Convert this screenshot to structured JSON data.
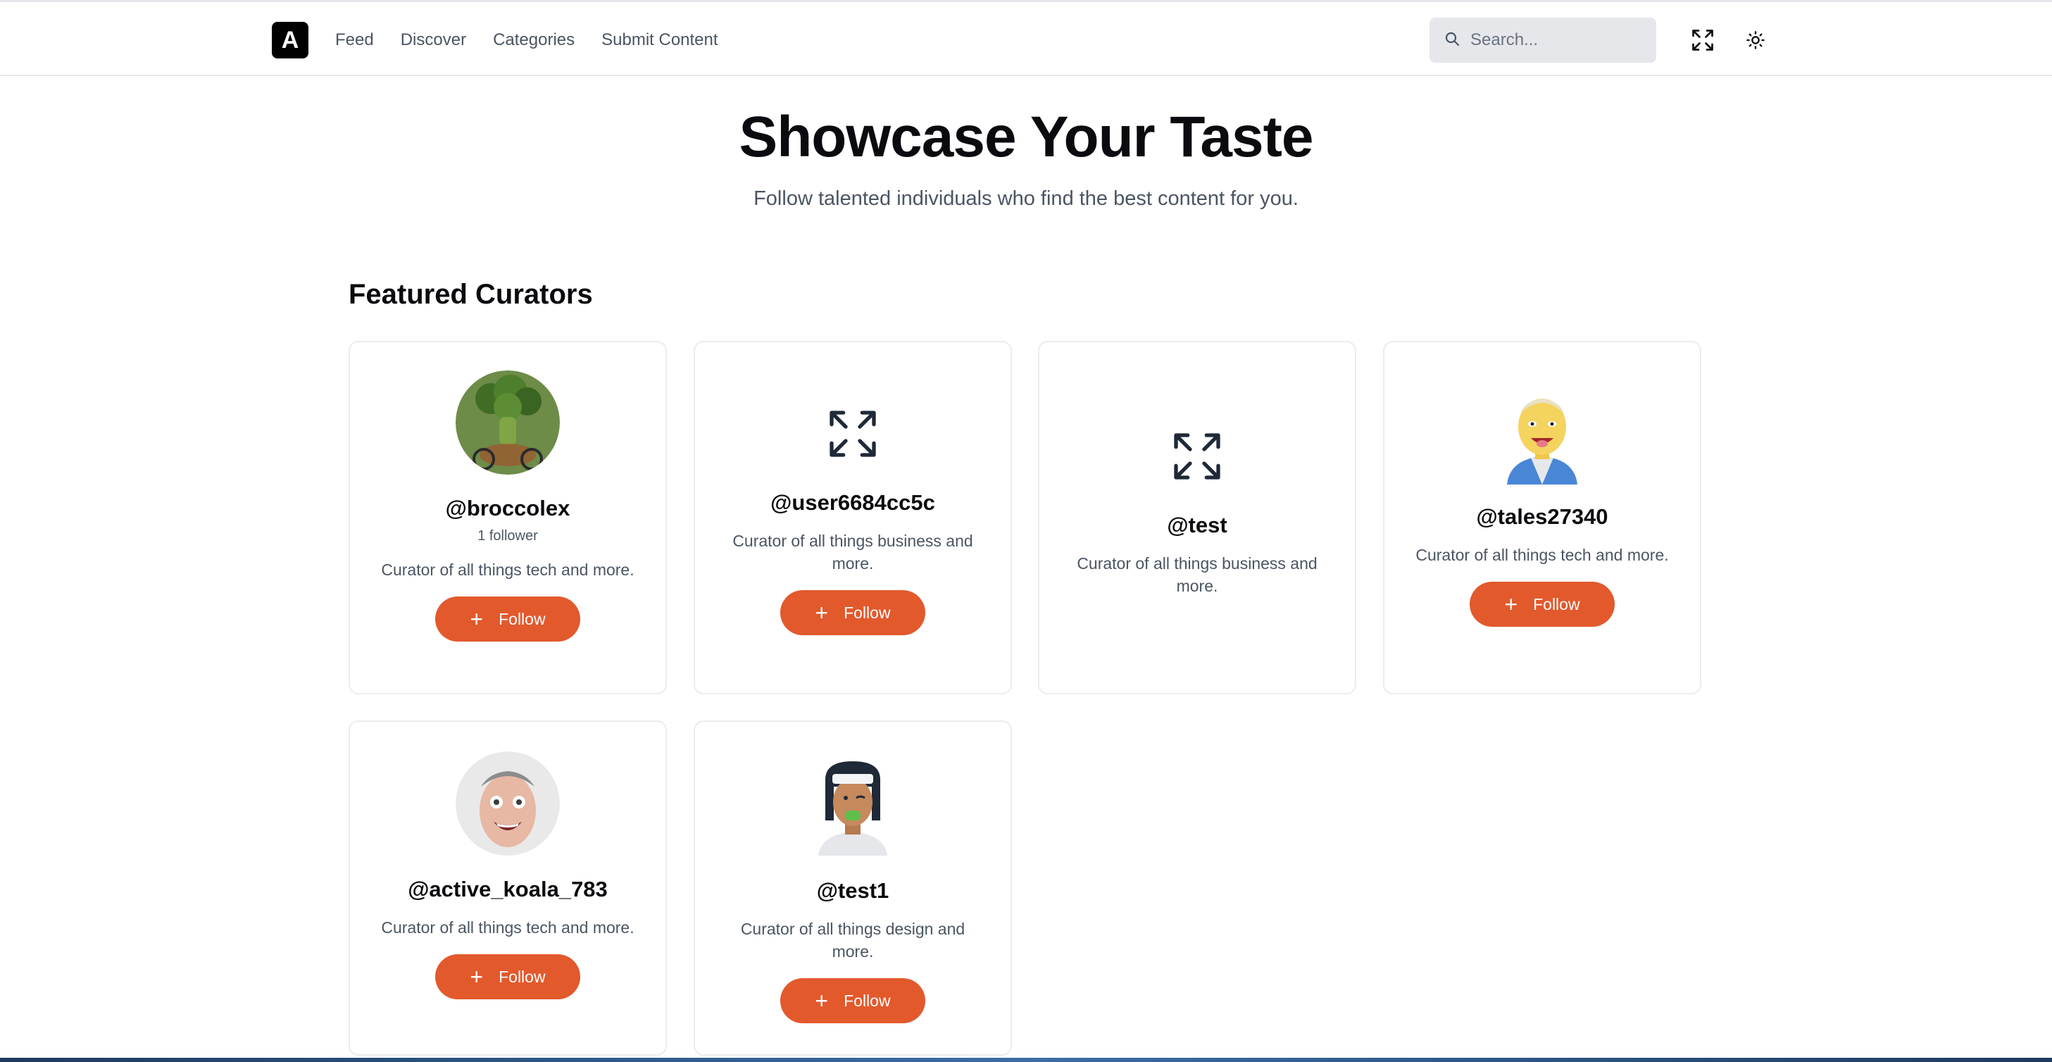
{
  "header": {
    "logo_letter": "A",
    "nav": [
      "Feed",
      "Discover",
      "Categories",
      "Submit Content"
    ],
    "search_placeholder": "Search...",
    "icons": [
      "search-icon",
      "expand-icon",
      "sun-icon"
    ]
  },
  "hero": {
    "title": "Showcase Your Taste",
    "subtitle": "Follow talented individuals who find the best content for you."
  },
  "section": {
    "title": "Featured Curators"
  },
  "curators": [
    {
      "username": "@broccolex",
      "followers": "1 follower",
      "bio": "Curator of all things tech and more.",
      "button": "Follow",
      "avatar": "broccoli-avatar"
    },
    {
      "username": "@user6684cc5c",
      "followers": "",
      "bio": "Curator of all things business and more.",
      "button": "Follow",
      "avatar": "expand-icon"
    },
    {
      "username": "@test",
      "followers": "",
      "bio": "Curator of all things business and more.",
      "button": "",
      "avatar": "expand-icon"
    },
    {
      "username": "@tales27340",
      "followers": "",
      "bio": "Curator of all things tech and more.",
      "button": "Follow",
      "avatar": "cartoon-man-avatar"
    },
    {
      "username": "@active_koala_783",
      "followers": "",
      "bio": "Curator of all things tech and more.",
      "button": "Follow",
      "avatar": "surprised-man-avatar"
    },
    {
      "username": "@test1",
      "followers": "",
      "bio": "Curator of all things design and more.",
      "button": "Follow",
      "avatar": "cartoon-person-avatar"
    }
  ],
  "colors": {
    "accent": "#e2592c",
    "text": "#0b0b0f",
    "muted": "#4b5563",
    "border": "#ececef"
  }
}
